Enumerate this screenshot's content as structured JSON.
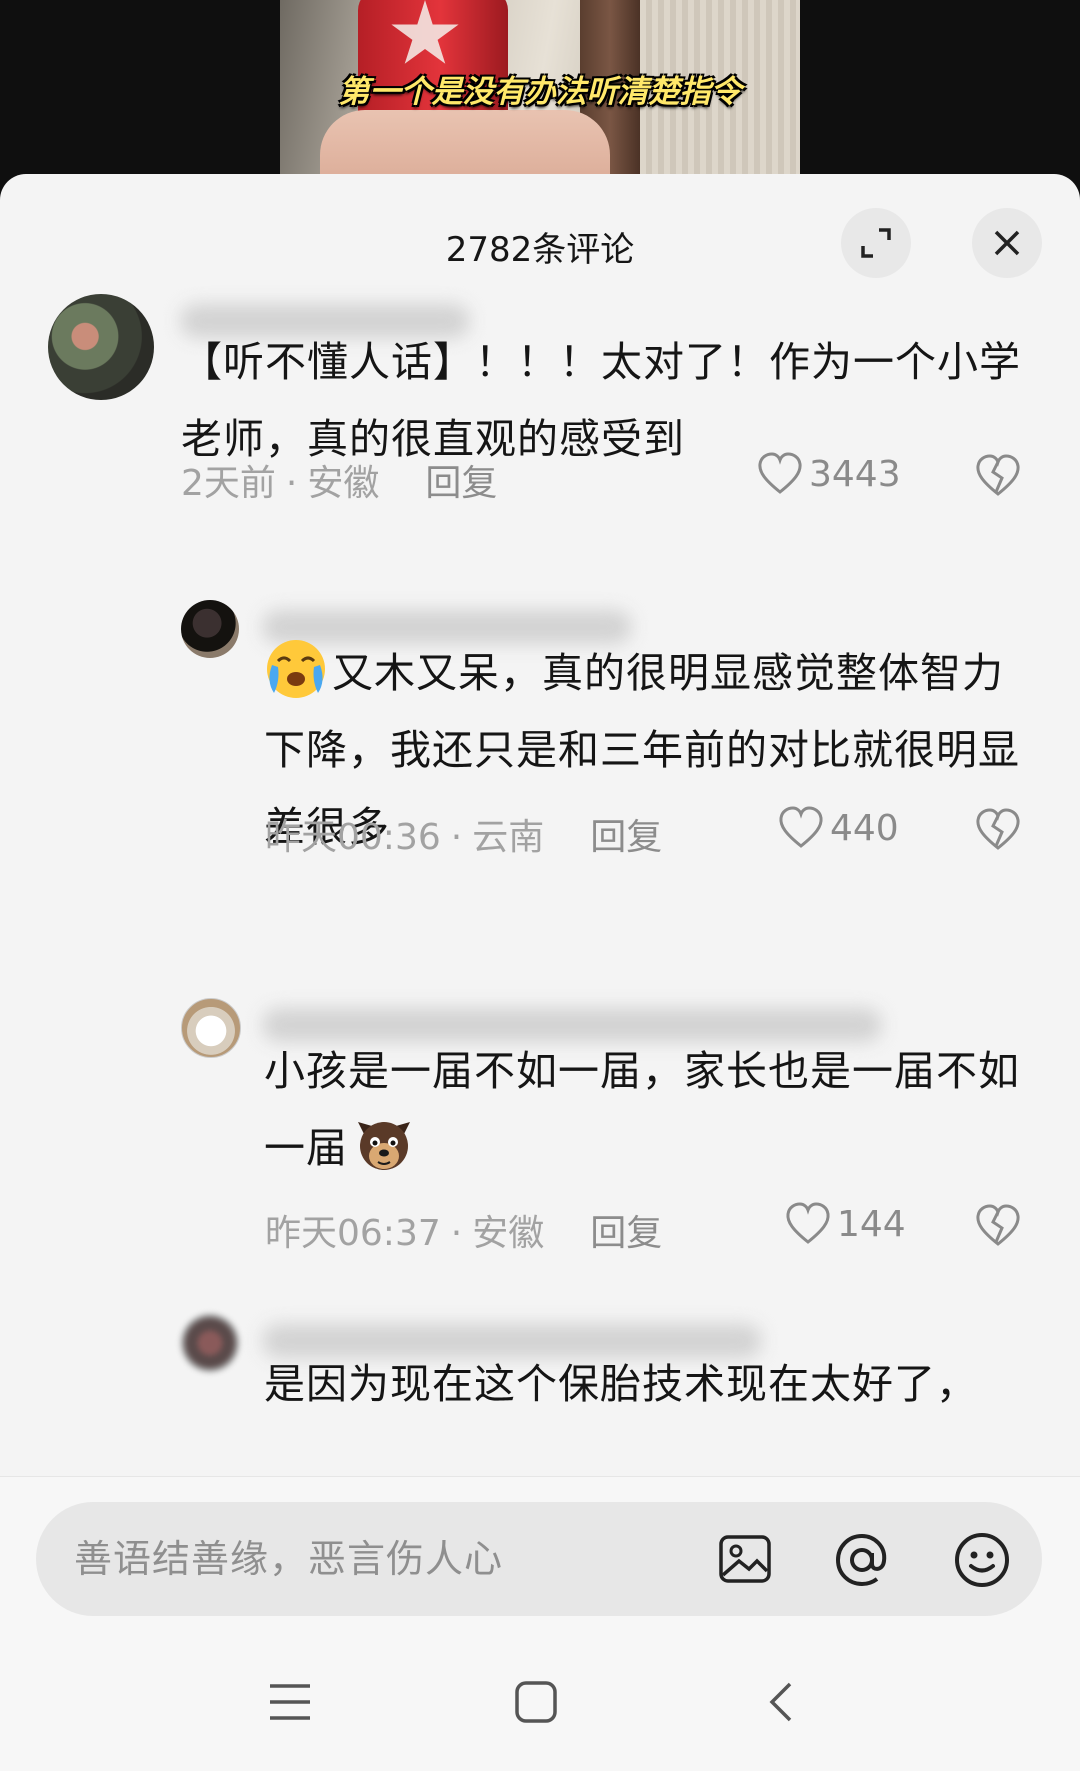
{
  "video": {
    "subtitle": "第一个是没有办法听清楚指令"
  },
  "panel": {
    "title": "2782条评论"
  },
  "comments": [
    {
      "text": "【听不懂人话】！！！太对了！作为一个小学老师，真的很直观的感受到",
      "time": "2天前",
      "location": "安徽",
      "reply_label": "回复",
      "likes": "3443"
    },
    {
      "text": "又木又呆，真的很明显感觉整体智力下降，我还只是和三年前的对比就很明显差很多",
      "emoji": "crying-face",
      "time": "昨天00:36",
      "location": "云南",
      "reply_label": "回复",
      "likes": "440"
    },
    {
      "text": "小孩是一届不如一届，家长也是一届不如一届",
      "emoji": "dog-face",
      "time": "昨天06:37",
      "location": "安徽",
      "reply_label": "回复",
      "likes": "144"
    },
    {
      "text": "是因为现在这个保胎技术现在太好了，"
    }
  ],
  "input": {
    "placeholder": "善语结善缘，恶言伤人心"
  },
  "icons": [
    "expand-icon",
    "close-icon",
    "heart-icon",
    "dislike-icon",
    "image-icon",
    "at-icon",
    "emoji-icon",
    "menu-icon",
    "home-icon",
    "back-icon"
  ]
}
